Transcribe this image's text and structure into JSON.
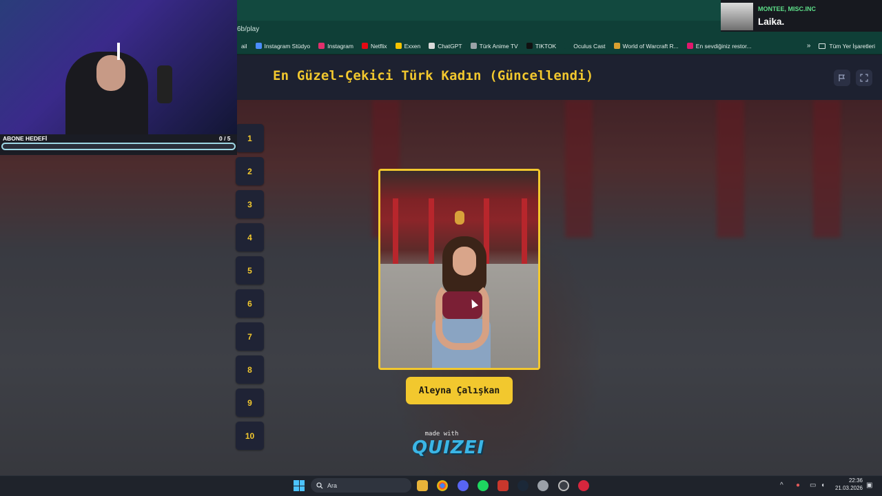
{
  "browser": {
    "address_fragment": "6b/play",
    "bookmarks": [
      {
        "label": "ail",
        "icon": "none",
        "color": "#0f3f37"
      },
      {
        "label": "Instagram Stüdyo",
        "icon": "meta-icon",
        "color": "#4a8dff"
      },
      {
        "label": "Instagram",
        "icon": "instagram-icon",
        "color": "#e1306c"
      },
      {
        "label": "Netflix",
        "icon": "netflix-icon",
        "color": "#e50914"
      },
      {
        "label": "Exxen",
        "icon": "exxen-icon",
        "color": "#f5c400"
      },
      {
        "label": "ChatGPT",
        "icon": "chatgpt-icon",
        "color": "#d9d9d9"
      },
      {
        "label": "Türk Anime TV",
        "icon": "anime-icon",
        "color": "#9aa3a8"
      },
      {
        "label": "TIKTOK",
        "icon": "tiktok-icon",
        "color": "#111111"
      },
      {
        "label": "Oculus Cast",
        "icon": "oculus-icon",
        "color": "#0f3f37"
      },
      {
        "label": "World of Warcraft R...",
        "icon": "wow-icon",
        "color": "#d9a030"
      },
      {
        "label": "En sevdiğiniz restor...",
        "icon": "yemeksepeti-icon",
        "color": "#e0186c"
      }
    ],
    "more_label": "»",
    "all_bookmarks_label": "Tüm Yer İşaretleri"
  },
  "quiz": {
    "title": "En Güzel-Çekici Türk Kadın (Güncellendi)",
    "ranks": [
      "1",
      "2",
      "3",
      "4",
      "5",
      "6",
      "7",
      "8",
      "9",
      "10"
    ],
    "current_candidate": "Aleyna Çalışkan",
    "made_with": "made with",
    "brand": "QUIZEI"
  },
  "stream_overlay": {
    "goal_label": "ABONE HEDEFİ",
    "goal_count": "0  / 5",
    "goal_progress": 0
  },
  "now_playing": {
    "artist": "MONTEE, MISC.INC",
    "track": "Laika."
  },
  "taskbar": {
    "search_placeholder": "Ara",
    "time": "22:36",
    "date": "21.03.2026"
  },
  "colors": {
    "accent": "#f2c82e",
    "header_bg": "#1d2130",
    "chrome_bg": "#0f3f37",
    "spotify_green": "#5ee08a"
  }
}
